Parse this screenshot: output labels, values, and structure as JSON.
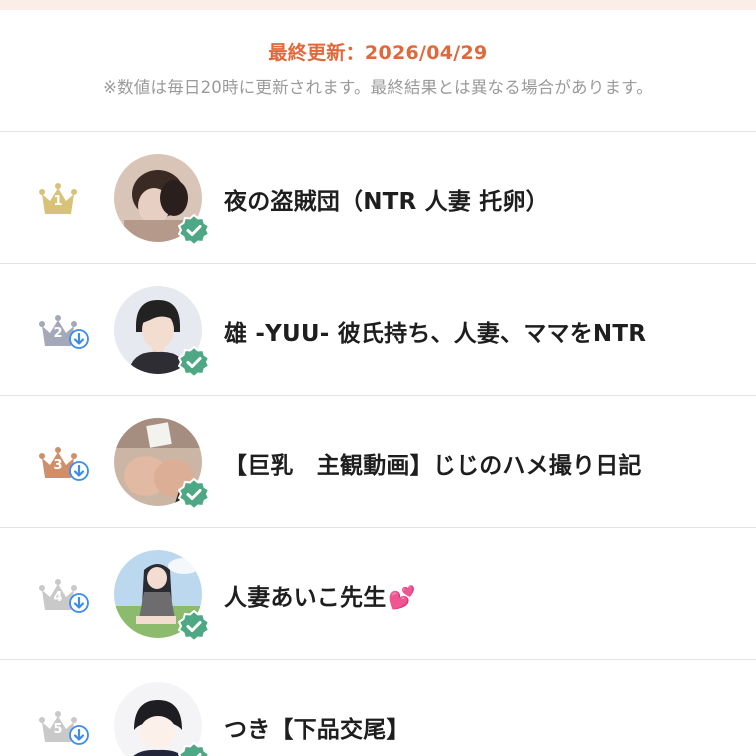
{
  "header": {
    "last_updated": "最終更新：2026/04/29",
    "note": "※数値は毎日20時に更新されます。最終結果とは異なる場合があります。"
  },
  "colors": {
    "accent": "#e0683a",
    "gold": "#d8c27a",
    "silver": "#a3a9b8",
    "bronze": "#cf8f6a",
    "gray": "#c9c9c9",
    "verified": "#4ea785",
    "down_arrow": "#3b8de8"
  },
  "ranking": [
    {
      "rank": "1",
      "name": "夜の盗賊団（NTR 人妻 托卵）",
      "crown": "gold-crown-icon",
      "trend": "none",
      "verified": true
    },
    {
      "rank": "2",
      "name": "雄 -YUU- 彼氏持ち、人妻、ママをNTR",
      "crown": "silver-crown-icon",
      "trend": "down-arrow-icon",
      "verified": true
    },
    {
      "rank": "3",
      "name": "【巨乳　主観動画】じじのハメ撮り日記",
      "crown": "bronze-crown-icon",
      "trend": "down-arrow-icon",
      "verified": true
    },
    {
      "rank": "4",
      "name": "人妻あいこ先生",
      "emoji": "💕",
      "crown": "gray-crown-icon",
      "trend": "down-arrow-icon",
      "verified": true
    },
    {
      "rank": "5",
      "name": "つき【下品交尾】",
      "crown": "gray-crown-icon",
      "trend": "down-arrow-icon",
      "verified": true
    }
  ]
}
